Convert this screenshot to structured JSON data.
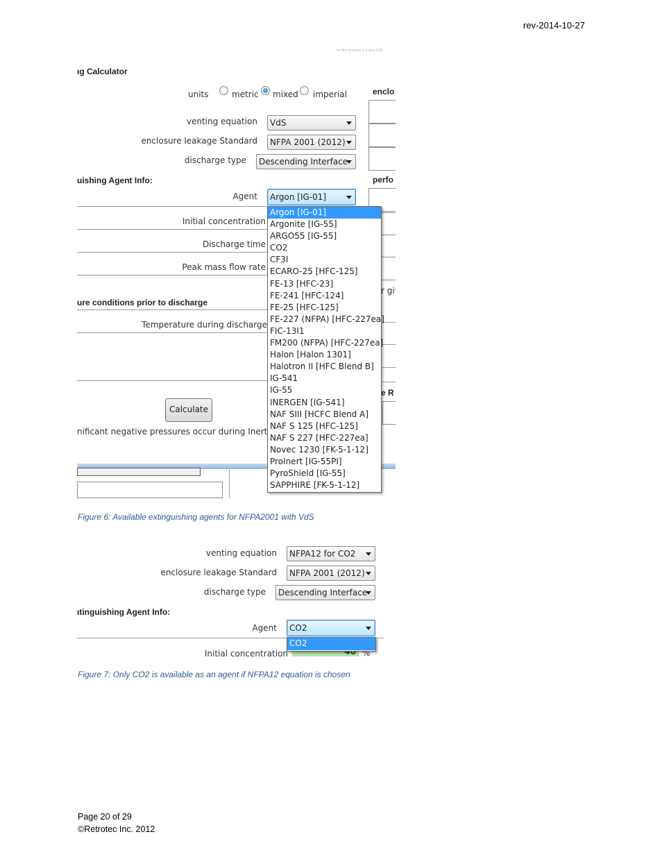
{
  "header": {
    "revision": "rev-2014-10-27"
  },
  "figure6": {
    "faint_title": "ra fire srvmter's ii iora 100",
    "section_calculator": "ıg Calculator",
    "units_label": "units",
    "units_options": [
      "metric",
      "mixed",
      "imperial"
    ],
    "units_selected": "mixed",
    "right_header_1": "enclo",
    "venting_equation_label": "venting equation",
    "venting_equation_value": "VdS",
    "leakage_standard_label": "enclosure leakage Standard",
    "leakage_standard_value": "NFPA 2001 (2012)",
    "discharge_type_label": "discharge type",
    "discharge_type_value": "Descending Interface",
    "section_agent_info": "uishing Agent Info:",
    "right_header_2": "perfo",
    "agent_label": "Agent",
    "agent_value": "Argon [IG-01]",
    "initial_conc_label": "Initial concentration",
    "discharge_time_label": "Discharge time",
    "peak_mass_label": "Peak mass flow rate",
    "right_partial_giv": "r giv",
    "section_pressure": "ure conditions prior to discharge",
    "temperature_label": "Temperature during discharge",
    "right_partial_er": "e R",
    "calculate_button": "Calculate",
    "negative_pressure_text": "nificant negative pressures occur during Inert Ag",
    "agent_options": [
      "Argon [IG-01]",
      "Argonite [IG-55]",
      "ARGO55 [IG-55]",
      "CO2",
      "CF3I",
      "ECARO-25 [HFC-125]",
      "FE-13 [HFC-23]",
      "FE-241 [HFC-124]",
      "FE-25 [HFC-125]",
      "FE-227 (NFPA) [HFC-227ea]",
      "FIC-13I1",
      "FM200 (NFPA) [HFC-227ea]",
      "Halon [Halon 1301]",
      "Halotron II [HFC Blend B]",
      "IG-541",
      "IG-55",
      "INERGEN [IG-541]",
      "NAF SIII [HCFC Blend A]",
      "NAF S 125 [HFC-125]",
      "NAF S 227 [HFC-227ea]",
      "Novec 1230 [FK-5-1-12]",
      "ProInert [IG-55PI]",
      "PyroShield [IG-55]",
      "SAPPHIRE [FK-5-1-12]"
    ],
    "agent_selected_index": 0,
    "caption": "Figure 6:  Available extinguishing agents for NFPA2001 with VdS"
  },
  "figure7": {
    "venting_equation_label": "venting equation",
    "venting_equation_value": "NFPA12 for CO2",
    "leakage_standard_label": "enclosure leakage Standard",
    "leakage_standard_value": "NFPA 2001 (2012)",
    "discharge_type_label": "discharge type",
    "discharge_type_value": "Descending Interface",
    "section_agent_info": "ıtinguishing Agent Info:",
    "agent_label": "Agent",
    "agent_value": "CO2",
    "agent_options": [
      "CO2"
    ],
    "initial_conc_label": "Initial concentration",
    "initial_conc_value": "40",
    "initial_conc_unit": "%",
    "caption": "Figure 7:  Only CO2 is available as an agent if NFPA12 equation is chosen"
  },
  "footer": {
    "page": "Page 20 of 29",
    "copyright": "©Retrotec Inc. 2012"
  },
  "colors": {
    "caption": "#2e5b9b",
    "selection": "#3399ff",
    "focus_border": "#3c7fb1"
  }
}
